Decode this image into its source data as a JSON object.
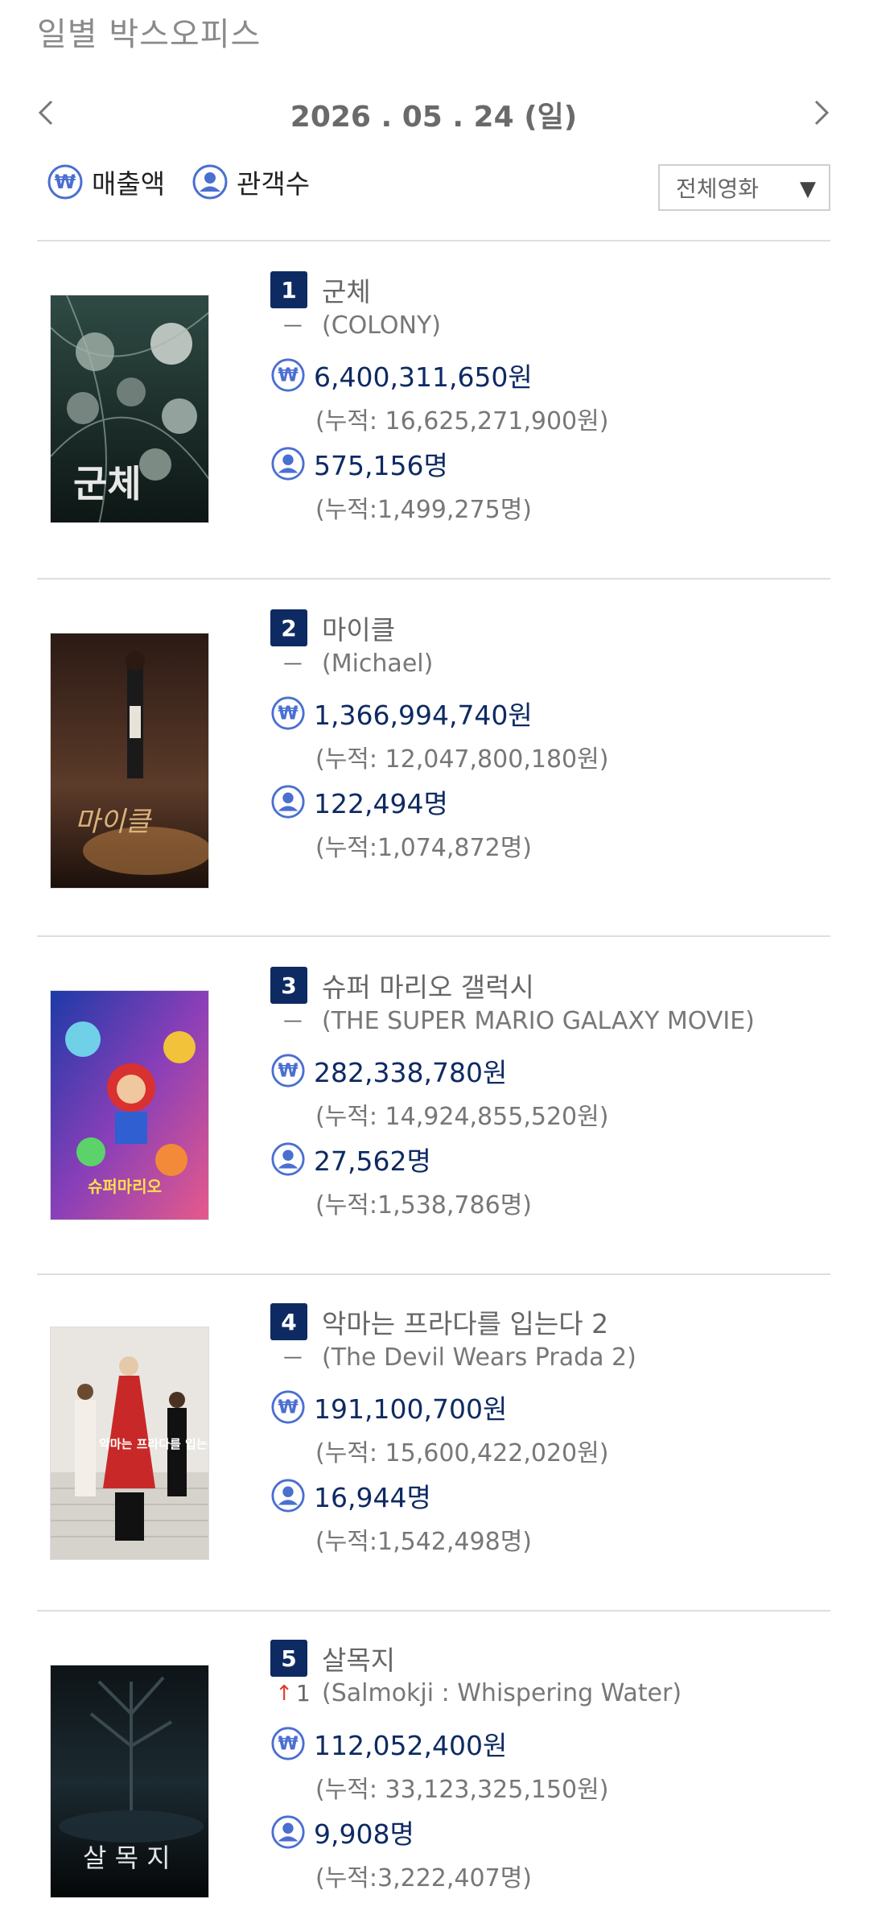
{
  "header": {
    "title": "일별 박스오피스"
  },
  "date_nav": {
    "date": "2026 . 05 . 24  (일)"
  },
  "filters": {
    "sales_label": "매출액",
    "audience_label": "관객수",
    "select_value": "전체영화"
  },
  "colors": {
    "brand": "#0e2a63",
    "icon": "#4a6fd1",
    "up": "#e03c2b"
  },
  "movies": [
    {
      "rank": "1",
      "title_ko": "군체",
      "change": "ㅡ",
      "title_en": "(COLONY)",
      "sales": "6,400,311,650원",
      "sales_cum": "(누적: 16,625,271,900원)",
      "audience": "575,156명",
      "audience_cum": "(누적:1,499,275명)",
      "poster_text": "군체"
    },
    {
      "rank": "2",
      "title_ko": "마이클",
      "change": "ㅡ",
      "title_en": "(Michael)",
      "sales": "1,366,994,740원",
      "sales_cum": "(누적: 12,047,800,180원)",
      "audience": "122,494명",
      "audience_cum": "(누적:1,074,872명)",
      "poster_text": "마이클"
    },
    {
      "rank": "3",
      "title_ko": "슈퍼 마리오 갤럭시",
      "change": "ㅡ",
      "title_en": "(THE SUPER MARIO GALAXY MOVIE)",
      "sales": "282,338,780원",
      "sales_cum": "(누적: 14,924,855,520원)",
      "audience": "27,562명",
      "audience_cum": "(누적:1,538,786명)",
      "poster_text": "슈퍼마리오"
    },
    {
      "rank": "4",
      "title_ko": "악마는 프라다를 입는다 2",
      "change": "ㅡ",
      "title_en": "(The Devil Wears Prada 2)",
      "sales": "191,100,700원",
      "sales_cum": "(누적: 15,600,422,020원)",
      "audience": "16,944명",
      "audience_cum": "(누적:1,542,498명)",
      "poster_text": "악마는 프라다를 입는다"
    },
    {
      "rank": "5",
      "title_ko": "살목지",
      "change_arrow": "↑",
      "change": "1",
      "title_en": "(Salmokji : Whispering Water)",
      "sales": "112,052,400원",
      "sales_cum": "(누적: 33,123,325,150원)",
      "audience": "9,908명",
      "audience_cum": "(누적:3,222,407명)",
      "poster_text": "살 목 지"
    }
  ]
}
